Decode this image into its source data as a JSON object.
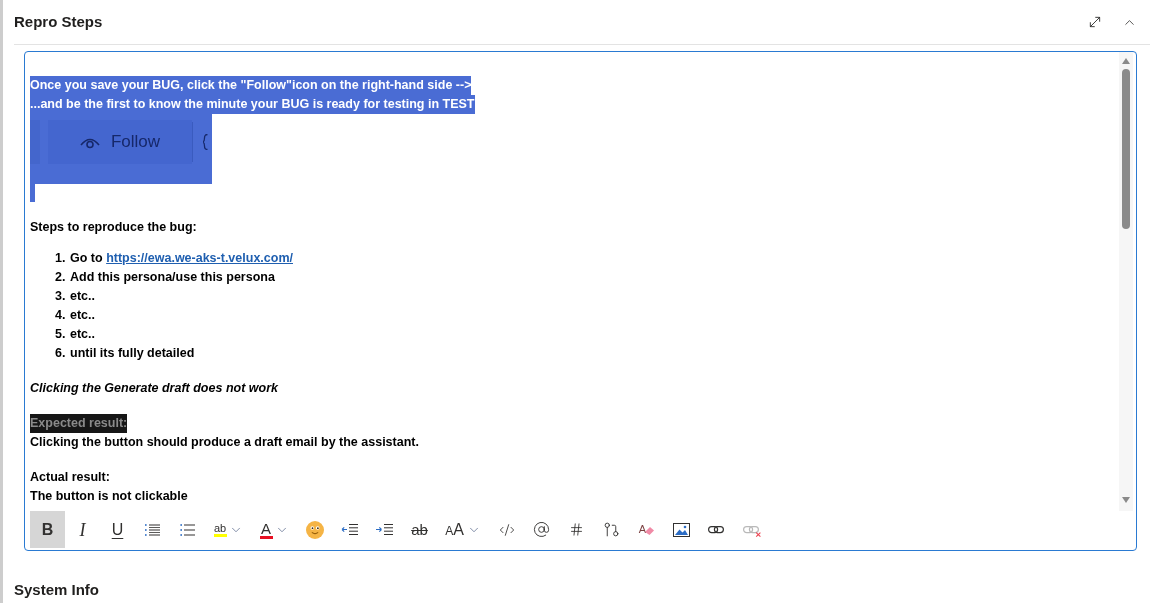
{
  "section": {
    "title": "Repro Steps"
  },
  "editor": {
    "content": [
      {
        "kind": "paragraph",
        "selected": true,
        "italic": false,
        "lines": [
          {
            "text": "Once you save your BUG, click the \"Follow\"icon on the right-hand side -->",
            "highlighted": false
          },
          {
            "text": "...and be the first to know the minute your BUG is ready for testing in TEST",
            "highlighted": false
          }
        ]
      },
      {
        "kind": "image",
        "selected": true,
        "button_label": "Follow"
      },
      {
        "kind": "empty",
        "selected": true
      },
      {
        "kind": "paragraph",
        "selected": false,
        "italic": false,
        "lines": [
          {
            "text": "Steps to reproduce the bug:",
            "highlighted": false
          }
        ]
      },
      {
        "kind": "list",
        "items": [
          {
            "marker": "1.",
            "text": "Go to",
            "link": "https://ewa.we-aks-t.velux.com/"
          },
          {
            "marker": "2.",
            "text": "Add this persona/use this persona"
          },
          {
            "marker": "3.",
            "text": "etc.."
          },
          {
            "marker": "4.",
            "text": "etc.."
          },
          {
            "marker": "5.",
            "text": "etc.."
          },
          {
            "marker": "6.",
            "text": "until its fully detailed"
          }
        ]
      },
      {
        "kind": "paragraph",
        "selected": false,
        "italic": true,
        "lines": [
          {
            "text": "Clicking the Generate draft does not work",
            "highlighted": false
          }
        ]
      },
      {
        "kind": "paragraph",
        "selected": false,
        "italic": false,
        "lines": [
          {
            "text": "Expected result:",
            "highlighted": true
          },
          {
            "text": "Clicking the button should produce a draft email by the assistant.",
            "highlighted": false
          }
        ]
      },
      {
        "kind": "paragraph",
        "selected": false,
        "italic": false,
        "lines": [
          {
            "text": "Actual result:",
            "highlighted": false
          },
          {
            "text": "The button is not clickable",
            "highlighted": false
          }
        ]
      }
    ],
    "toolbar": [
      {
        "kind": "bold",
        "label": "B",
        "active": true,
        "disabled": false
      },
      {
        "kind": "italic",
        "label": "I",
        "active": false,
        "disabled": false
      },
      {
        "kind": "underline",
        "label": "U",
        "active": false,
        "disabled": false
      },
      {
        "kind": "bulleted_list",
        "active": false,
        "disabled": false
      },
      {
        "kind": "numbered_list",
        "active": false,
        "disabled": false
      },
      {
        "kind": "highlight",
        "label": "ab",
        "color": "#ffff00",
        "active": false,
        "disabled": false
      },
      {
        "kind": "font_color",
        "label": "A",
        "color": "#e81123",
        "active": false,
        "disabled": false
      },
      {
        "kind": "emoji",
        "active": false,
        "disabled": false
      },
      {
        "kind": "outdent",
        "active": false,
        "disabled": false
      },
      {
        "kind": "indent",
        "active": false,
        "disabled": false
      },
      {
        "kind": "strikethrough",
        "label": "ab",
        "active": false,
        "disabled": false
      },
      {
        "kind": "font_size",
        "label": "AA",
        "active": false,
        "disabled": false
      },
      {
        "kind": "code",
        "active": false,
        "disabled": false
      },
      {
        "kind": "mention",
        "active": false,
        "disabled": false
      },
      {
        "kind": "tag",
        "active": false,
        "disabled": false
      },
      {
        "kind": "pull_request",
        "active": false,
        "disabled": false
      },
      {
        "kind": "clear_formatting",
        "label": "A",
        "active": false,
        "disabled": false
      },
      {
        "kind": "image",
        "active": false,
        "disabled": false
      },
      {
        "kind": "link",
        "active": false,
        "disabled": false
      },
      {
        "kind": "unlink",
        "active": false,
        "disabled": true
      }
    ]
  },
  "next_section": {
    "title": "System Info"
  }
}
